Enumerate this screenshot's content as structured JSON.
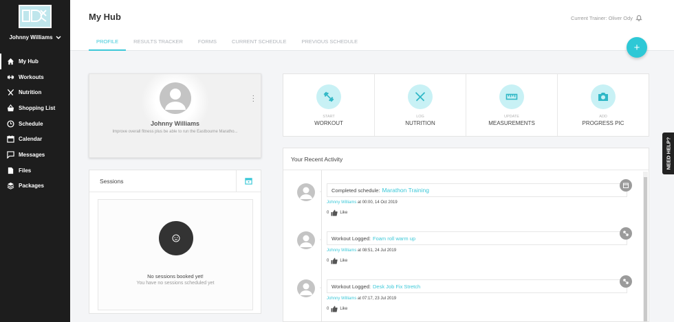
{
  "sidebar": {
    "user_name": "Johnny Williams",
    "items": [
      {
        "label": "My Hub",
        "icon": "home-icon"
      },
      {
        "label": "Workouts",
        "icon": "dumbbell-icon"
      },
      {
        "label": "Nutrition",
        "icon": "utensils-icon"
      },
      {
        "label": "Shopping List",
        "icon": "basket-icon"
      },
      {
        "label": "Schedule",
        "icon": "clock-icon"
      },
      {
        "label": "Calendar",
        "icon": "calendar-icon"
      },
      {
        "label": "Messages",
        "icon": "chat-icon"
      },
      {
        "label": "Files",
        "icon": "file-icon"
      },
      {
        "label": "Packages",
        "icon": "layers-icon"
      }
    ]
  },
  "header": {
    "title": "My Hub",
    "trainer": "Current Trainer: Oliver Ody",
    "tabs": [
      "PROFILE",
      "RESULTS TRACKER",
      "FORMS",
      "CURRENT SCHEDULE",
      "PREVIOUS SCHEDULE"
    ],
    "fab_label": "+"
  },
  "profile": {
    "name": "Johnny Williams",
    "goal": "Improve overall fitness plus be able to run the Eastbourne Maratho..."
  },
  "sessions": {
    "title": "Sessions",
    "empty_title": "No sessions booked yet!",
    "empty_sub": "You have no sessions scheduled yet"
  },
  "actions": [
    {
      "small": "START",
      "big": "WORKOUT",
      "icon": "dumbbell-icon"
    },
    {
      "small": "LOG",
      "big": "NUTRITION",
      "icon": "utensils-icon"
    },
    {
      "small": "UPDATE",
      "big": "MEASUREMENTS",
      "icon": "ruler-icon"
    },
    {
      "small": "ADD",
      "big": "PROGRESS PIC",
      "icon": "camera-icon"
    }
  ],
  "activity": {
    "title": "Your Recent Activity",
    "items": [
      {
        "prefix": "Completed schedule:",
        "highlight": "Marathon Training",
        "who": "Johnny Williams",
        "when": " at 00:00, 14 Oct 2019",
        "likes": "0",
        "like_label": "Like",
        "badge": "calendar-icon"
      },
      {
        "prefix": "Workout Logged:",
        "highlight": "Foam roll warm up",
        "who": "Johnny Williams",
        "when": " at 08:51, 24 Jul 2019",
        "likes": "0",
        "like_label": "Like",
        "badge": "dumbbell-icon"
      },
      {
        "prefix": "Workout Logged:",
        "highlight": "Desk Job Fix Stretch",
        "who": "Johnny Williams",
        "when": " at 07:17, 23 Jul 2019",
        "likes": "0",
        "like_label": "Like",
        "badge": "dumbbell-icon"
      }
    ]
  },
  "help": {
    "label": "NEED HELP?"
  },
  "colors": {
    "accent": "#3cc8d8",
    "sidebar": "#1d1d1d",
    "action_circle": "#c8f1f5"
  }
}
